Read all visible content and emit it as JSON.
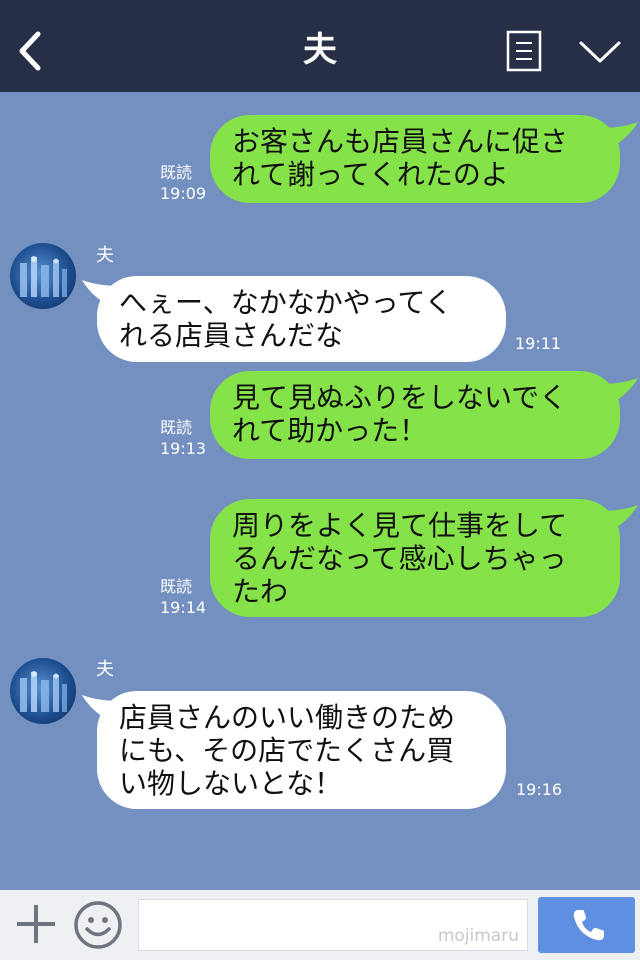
{
  "header": {
    "title": "夫",
    "back_icon": "chevron-left-icon",
    "notes_icon": "notes-icon",
    "menu_icon": "chevron-down-icon"
  },
  "messages": [
    {
      "side": "sent",
      "lines": [
        "お客さんも店員さんに促さ",
        "れて謝ってくれたのよ"
      ],
      "read": "既読",
      "time": "19:09"
    },
    {
      "side": "received",
      "sender": "夫",
      "lines": [
        "へぇー、なかなかやってく",
        "れる店員さんだな"
      ],
      "time": "19:11"
    },
    {
      "side": "sent",
      "lines": [
        "見て見ぬふりをしないでく",
        "れて助かった！"
      ],
      "read": "既読",
      "time": "19:13"
    },
    {
      "side": "sent",
      "lines": [
        "周りをよく見て仕事をして",
        "るんだなって感心しちゃっ",
        "たわ"
      ],
      "read": "既読",
      "time": "19:14"
    },
    {
      "side": "received",
      "sender": "夫",
      "lines": [
        "店員さんのいい働きのため",
        "にも、その店でたくさん買",
        "い物しないとな！"
      ],
      "time": "19:16"
    }
  ],
  "input_bar": {
    "plus_icon": "plus-icon",
    "emoji_icon": "smiley-icon",
    "watermark": "mojimaru",
    "call_icon": "phone-icon"
  },
  "colors": {
    "header_bg": "#262f45",
    "chat_bg": "#7490c0",
    "sent_bubble": "#85e249",
    "received_bubble": "#ffffff",
    "call_button": "#5e8fe0"
  }
}
